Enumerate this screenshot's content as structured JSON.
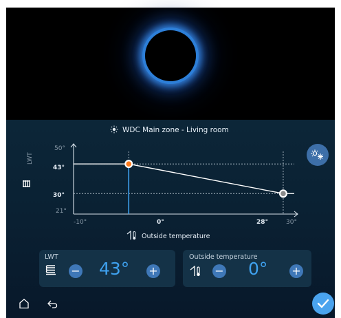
{
  "header": {
    "zone_title": "WDC Main zone - Living room"
  },
  "chart_data": {
    "type": "line",
    "title": "WDC Main zone - Living room",
    "xlabel": "Outside temperature",
    "ylabel": "LWT",
    "x_ticks": [
      "-10°",
      "0°",
      "28°",
      "30°"
    ],
    "y_ticks": [
      "50°",
      "43°",
      "30°",
      "21°"
    ],
    "xlim": [
      -10,
      30
    ],
    "ylim": [
      21,
      50
    ],
    "series": [
      {
        "x": [
          -10,
          0,
          28,
          30
        ],
        "y": [
          43,
          43,
          30,
          30
        ]
      }
    ],
    "points": [
      {
        "x": 0,
        "y": 43,
        "label_x": "0°",
        "label_y": "43°",
        "color": "#ff7a1a"
      },
      {
        "x": 28,
        "y": 30,
        "label_x": "28°",
        "label_y": "30°",
        "color": "#8a8a8a"
      }
    ]
  },
  "lwt_card": {
    "title": "LWT",
    "value": "43°",
    "minus": "−",
    "plus": "+"
  },
  "outside_card": {
    "title": "Outside temperature",
    "value": "0°",
    "minus": "−",
    "plus": "+"
  },
  "colors": {
    "accent": "#3fa2f0",
    "button": "#3f78b8",
    "confirm": "#4aa3ee",
    "orange": "#ff7a1a"
  }
}
